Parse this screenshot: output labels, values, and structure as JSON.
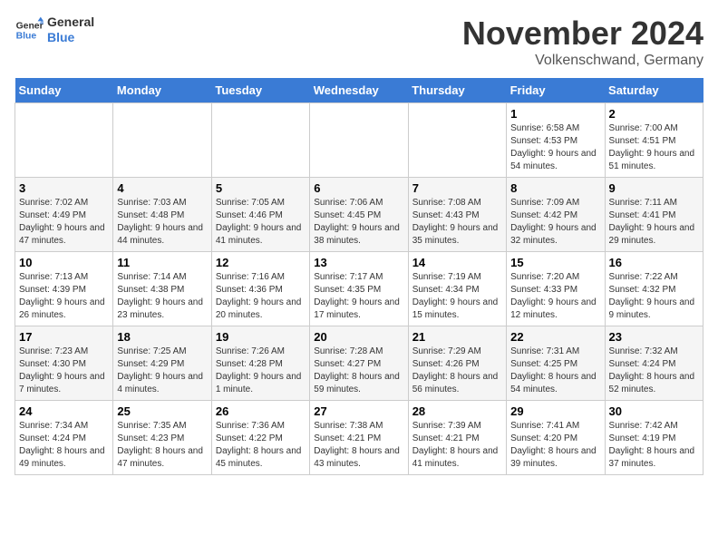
{
  "logo": {
    "line1": "General",
    "line2": "Blue"
  },
  "title": "November 2024",
  "location": "Volkenschwand, Germany",
  "days_header": [
    "Sunday",
    "Monday",
    "Tuesday",
    "Wednesday",
    "Thursday",
    "Friday",
    "Saturday"
  ],
  "weeks": [
    [
      {
        "day": "",
        "sunrise": "",
        "sunset": "",
        "daylight": ""
      },
      {
        "day": "",
        "sunrise": "",
        "sunset": "",
        "daylight": ""
      },
      {
        "day": "",
        "sunrise": "",
        "sunset": "",
        "daylight": ""
      },
      {
        "day": "",
        "sunrise": "",
        "sunset": "",
        "daylight": ""
      },
      {
        "day": "",
        "sunrise": "",
        "sunset": "",
        "daylight": ""
      },
      {
        "day": "1",
        "sunrise": "Sunrise: 6:58 AM",
        "sunset": "Sunset: 4:53 PM",
        "daylight": "Daylight: 9 hours and 54 minutes."
      },
      {
        "day": "2",
        "sunrise": "Sunrise: 7:00 AM",
        "sunset": "Sunset: 4:51 PM",
        "daylight": "Daylight: 9 hours and 51 minutes."
      }
    ],
    [
      {
        "day": "3",
        "sunrise": "Sunrise: 7:02 AM",
        "sunset": "Sunset: 4:49 PM",
        "daylight": "Daylight: 9 hours and 47 minutes."
      },
      {
        "day": "4",
        "sunrise": "Sunrise: 7:03 AM",
        "sunset": "Sunset: 4:48 PM",
        "daylight": "Daylight: 9 hours and 44 minutes."
      },
      {
        "day": "5",
        "sunrise": "Sunrise: 7:05 AM",
        "sunset": "Sunset: 4:46 PM",
        "daylight": "Daylight: 9 hours and 41 minutes."
      },
      {
        "day": "6",
        "sunrise": "Sunrise: 7:06 AM",
        "sunset": "Sunset: 4:45 PM",
        "daylight": "Daylight: 9 hours and 38 minutes."
      },
      {
        "day": "7",
        "sunrise": "Sunrise: 7:08 AM",
        "sunset": "Sunset: 4:43 PM",
        "daylight": "Daylight: 9 hours and 35 minutes."
      },
      {
        "day": "8",
        "sunrise": "Sunrise: 7:09 AM",
        "sunset": "Sunset: 4:42 PM",
        "daylight": "Daylight: 9 hours and 32 minutes."
      },
      {
        "day": "9",
        "sunrise": "Sunrise: 7:11 AM",
        "sunset": "Sunset: 4:41 PM",
        "daylight": "Daylight: 9 hours and 29 minutes."
      }
    ],
    [
      {
        "day": "10",
        "sunrise": "Sunrise: 7:13 AM",
        "sunset": "Sunset: 4:39 PM",
        "daylight": "Daylight: 9 hours and 26 minutes."
      },
      {
        "day": "11",
        "sunrise": "Sunrise: 7:14 AM",
        "sunset": "Sunset: 4:38 PM",
        "daylight": "Daylight: 9 hours and 23 minutes."
      },
      {
        "day": "12",
        "sunrise": "Sunrise: 7:16 AM",
        "sunset": "Sunset: 4:36 PM",
        "daylight": "Daylight: 9 hours and 20 minutes."
      },
      {
        "day": "13",
        "sunrise": "Sunrise: 7:17 AM",
        "sunset": "Sunset: 4:35 PM",
        "daylight": "Daylight: 9 hours and 17 minutes."
      },
      {
        "day": "14",
        "sunrise": "Sunrise: 7:19 AM",
        "sunset": "Sunset: 4:34 PM",
        "daylight": "Daylight: 9 hours and 15 minutes."
      },
      {
        "day": "15",
        "sunrise": "Sunrise: 7:20 AM",
        "sunset": "Sunset: 4:33 PM",
        "daylight": "Daylight: 9 hours and 12 minutes."
      },
      {
        "day": "16",
        "sunrise": "Sunrise: 7:22 AM",
        "sunset": "Sunset: 4:32 PM",
        "daylight": "Daylight: 9 hours and 9 minutes."
      }
    ],
    [
      {
        "day": "17",
        "sunrise": "Sunrise: 7:23 AM",
        "sunset": "Sunset: 4:30 PM",
        "daylight": "Daylight: 9 hours and 7 minutes."
      },
      {
        "day": "18",
        "sunrise": "Sunrise: 7:25 AM",
        "sunset": "Sunset: 4:29 PM",
        "daylight": "Daylight: 9 hours and 4 minutes."
      },
      {
        "day": "19",
        "sunrise": "Sunrise: 7:26 AM",
        "sunset": "Sunset: 4:28 PM",
        "daylight": "Daylight: 9 hours and 1 minute."
      },
      {
        "day": "20",
        "sunrise": "Sunrise: 7:28 AM",
        "sunset": "Sunset: 4:27 PM",
        "daylight": "Daylight: 8 hours and 59 minutes."
      },
      {
        "day": "21",
        "sunrise": "Sunrise: 7:29 AM",
        "sunset": "Sunset: 4:26 PM",
        "daylight": "Daylight: 8 hours and 56 minutes."
      },
      {
        "day": "22",
        "sunrise": "Sunrise: 7:31 AM",
        "sunset": "Sunset: 4:25 PM",
        "daylight": "Daylight: 8 hours and 54 minutes."
      },
      {
        "day": "23",
        "sunrise": "Sunrise: 7:32 AM",
        "sunset": "Sunset: 4:24 PM",
        "daylight": "Daylight: 8 hours and 52 minutes."
      }
    ],
    [
      {
        "day": "24",
        "sunrise": "Sunrise: 7:34 AM",
        "sunset": "Sunset: 4:24 PM",
        "daylight": "Daylight: 8 hours and 49 minutes."
      },
      {
        "day": "25",
        "sunrise": "Sunrise: 7:35 AM",
        "sunset": "Sunset: 4:23 PM",
        "daylight": "Daylight: 8 hours and 47 minutes."
      },
      {
        "day": "26",
        "sunrise": "Sunrise: 7:36 AM",
        "sunset": "Sunset: 4:22 PM",
        "daylight": "Daylight: 8 hours and 45 minutes."
      },
      {
        "day": "27",
        "sunrise": "Sunrise: 7:38 AM",
        "sunset": "Sunset: 4:21 PM",
        "daylight": "Daylight: 8 hours and 43 minutes."
      },
      {
        "day": "28",
        "sunrise": "Sunrise: 7:39 AM",
        "sunset": "Sunset: 4:21 PM",
        "daylight": "Daylight: 8 hours and 41 minutes."
      },
      {
        "day": "29",
        "sunrise": "Sunrise: 7:41 AM",
        "sunset": "Sunset: 4:20 PM",
        "daylight": "Daylight: 8 hours and 39 minutes."
      },
      {
        "day": "30",
        "sunrise": "Sunrise: 7:42 AM",
        "sunset": "Sunset: 4:19 PM",
        "daylight": "Daylight: 8 hours and 37 minutes."
      }
    ]
  ]
}
